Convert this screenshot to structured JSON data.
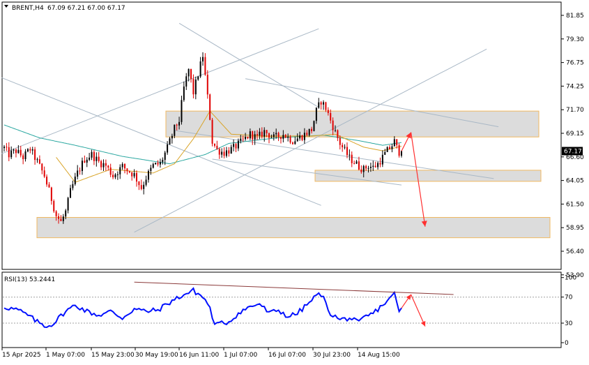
{
  "header": {
    "symbol_text": "BRENT,H4",
    "ohlc_text": "67.09 67.21 67.00 67.17"
  },
  "rsi_panel": {
    "label": "RSI(13) 53.2441",
    "ticks": [
      "100",
      "70",
      "30",
      "0"
    ]
  },
  "price_axis": {
    "ticks": [
      "81.85",
      "79.30",
      "76.75",
      "74.25",
      "71.70",
      "69.15",
      "66.60",
      "64.05",
      "61.50",
      "58.95",
      "56.40",
      "53.90"
    ],
    "current_price_label": "67.17"
  },
  "time_axis": {
    "ticks": [
      "15 Apr 2025",
      "1 May 07:00",
      "15 May 23:00",
      "30 May 19:00",
      "16 Jun 11:00",
      "1 Jul 07:00",
      "16 Jul 07:00",
      "30 Jul 23:00",
      "14 Aug 15:00"
    ]
  },
  "colors": {
    "bull_candle": "#000000",
    "bear_candle": "#e00000",
    "ma_fast": "#d9a428",
    "ma_slow": "#2aa7a0",
    "trendline": "#a9b8c6",
    "zone_fill": "#dcdcdc",
    "zone_border": "#f0b860",
    "rsi_line": "#0010ff",
    "rsi_divergence": "#8b3a3a",
    "forecast_arrow": "#ff3030"
  },
  "chart_data": {
    "type": "candlestick",
    "symbol": "BRENT",
    "timeframe": "H4",
    "ylim": [
      53.9,
      82.85
    ],
    "last_price": 67.17,
    "price_path_anchors": [
      [
        0,
        67.5
      ],
      [
        2,
        66.8
      ],
      [
        5,
        67.2
      ],
      [
        8,
        66.5
      ],
      [
        11,
        67.4
      ],
      [
        14,
        66.0
      ],
      [
        17,
        64.5
      ],
      [
        20,
        62.0
      ],
      [
        22,
        60.2
      ],
      [
        24,
        59.5
      ],
      [
        26,
        60.6
      ],
      [
        28,
        62.8
      ],
      [
        31,
        64.8
      ],
      [
        34,
        66.3
      ],
      [
        37,
        66.8
      ],
      [
        40,
        66.0
      ],
      [
        43,
        65.6
      ],
      [
        46,
        64.5
      ],
      [
        50,
        65.5
      ],
      [
        55,
        64.6
      ],
      [
        58,
        63.2
      ],
      [
        60,
        64.3
      ],
      [
        63,
        65.6
      ],
      [
        66,
        65.8
      ],
      [
        69,
        67.5
      ],
      [
        72,
        69.6
      ],
      [
        74,
        70.5
      ],
      [
        76,
        74.0
      ],
      [
        78,
        76.0
      ],
      [
        80,
        73.5
      ],
      [
        82,
        75.5
      ],
      [
        84,
        77.5
      ],
      [
        86,
        73.0
      ],
      [
        87,
        70.8
      ],
      [
        88,
        68.2
      ],
      [
        90,
        67.3
      ],
      [
        93,
        67.0
      ],
      [
        97,
        67.5
      ],
      [
        101,
        68.3
      ],
      [
        104,
        69.0
      ],
      [
        107,
        68.6
      ],
      [
        110,
        69.3
      ],
      [
        114,
        68.6
      ],
      [
        118,
        69.0
      ],
      [
        122,
        68.3
      ],
      [
        126,
        68.8
      ],
      [
        130,
        69.5
      ],
      [
        132,
        71.5
      ],
      [
        134,
        72.6
      ],
      [
        136,
        71.8
      ],
      [
        138,
        70.5
      ],
      [
        140,
        69.2
      ],
      [
        142,
        68.0
      ],
      [
        144,
        67.2
      ],
      [
        146,
        66.4
      ],
      [
        148,
        66.0
      ],
      [
        150,
        65.5
      ],
      [
        152,
        65.2
      ],
      [
        154,
        65.6
      ],
      [
        156,
        65.4
      ],
      [
        158,
        65.8
      ],
      [
        160,
        66.5
      ],
      [
        162,
        67.2
      ],
      [
        164,
        67.8
      ],
      [
        165,
        68.2
      ],
      [
        166,
        67.5
      ],
      [
        167,
        67.1
      ],
      [
        168,
        67.17
      ]
    ],
    "ma_fast_anchors": [
      [
        22,
        66.5
      ],
      [
        30,
        63.8
      ],
      [
        45,
        65.2
      ],
      [
        63,
        64.8
      ],
      [
        72,
        65.8
      ],
      [
        80,
        68.5
      ],
      [
        87,
        71.5
      ],
      [
        96,
        69.0
      ],
      [
        110,
        68.8
      ],
      [
        130,
        68.8
      ],
      [
        140,
        69.0
      ],
      [
        152,
        67.6
      ],
      [
        160,
        67.2
      ],
      [
        168,
        67.7
      ]
    ],
    "ma_slow_anchors": [
      [
        0,
        70.0
      ],
      [
        15,
        68.6
      ],
      [
        30,
        67.8
      ],
      [
        50,
        66.6
      ],
      [
        70,
        65.8
      ],
      [
        85,
        66.8
      ],
      [
        95,
        68.0
      ],
      [
        115,
        68.6
      ],
      [
        135,
        68.9
      ],
      [
        150,
        68.3
      ],
      [
        160,
        67.8
      ],
      [
        168,
        68.1
      ]
    ],
    "support_resistance_zones": [
      {
        "start": 71.5,
        "end": 68.7
      },
      {
        "start": 65.1,
        "end": 63.9
      },
      {
        "start": 60.0,
        "end": 57.8
      }
    ],
    "rsi": {
      "period": 13,
      "value": 53.2441,
      "ylim": [
        0,
        100
      ],
      "levels": [
        70,
        30
      ],
      "path_anchors": [
        [
          0,
          55
        ],
        [
          6,
          50
        ],
        [
          10,
          42
        ],
        [
          14,
          32
        ],
        [
          18,
          25
        ],
        [
          21,
          30
        ],
        [
          25,
          45
        ],
        [
          30,
          58
        ],
        [
          35,
          48
        ],
        [
          40,
          42
        ],
        [
          45,
          48
        ],
        [
          50,
          38
        ],
        [
          55,
          52
        ],
        [
          60,
          48
        ],
        [
          65,
          50
        ],
        [
          70,
          62
        ],
        [
          75,
          72
        ],
        [
          80,
          80
        ],
        [
          84,
          70
        ],
        [
          87,
          55
        ],
        [
          88,
          35
        ],
        [
          90,
          28
        ],
        [
          95,
          32
        ],
        [
          100,
          48
        ],
        [
          104,
          55
        ],
        [
          108,
          60
        ],
        [
          112,
          45
        ],
        [
          116,
          50
        ],
        [
          120,
          40
        ],
        [
          124,
          45
        ],
        [
          128,
          58
        ],
        [
          132,
          72
        ],
        [
          134,
          75
        ],
        [
          136,
          60
        ],
        [
          138,
          45
        ],
        [
          142,
          35
        ],
        [
          146,
          38
        ],
        [
          150,
          30
        ],
        [
          152,
          38
        ],
        [
          156,
          45
        ],
        [
          160,
          58
        ],
        [
          164,
          70
        ],
        [
          165,
          80
        ],
        [
          167,
          45
        ],
        [
          168,
          53
        ]
      ]
    }
  }
}
